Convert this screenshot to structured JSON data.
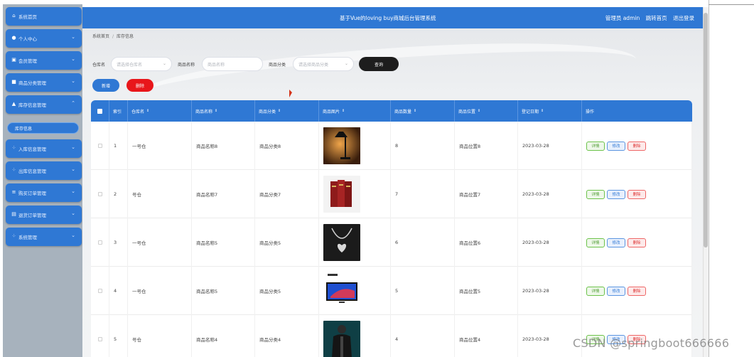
{
  "header": {
    "title": "基于Vue的loving buy商城后台管理系统",
    "user_label": "管理员 admin",
    "home_label": "跳转首页",
    "logout_label": "退出登录"
  },
  "sidebar": {
    "items": [
      {
        "label": "系统首页",
        "icon": "home-icon"
      },
      {
        "label": "个人中心",
        "icon": "user-icon"
      },
      {
        "label": "会员管理",
        "icon": "lock-icon"
      },
      {
        "label": "商品分类管理",
        "icon": "list-icon"
      },
      {
        "label": "库存信息管理",
        "icon": "doc-icon"
      },
      {
        "label": "入库信息管理",
        "icon": "grid-icon"
      },
      {
        "label": "出库信息管理",
        "icon": "grid-icon"
      },
      {
        "label": "购买订单管理",
        "icon": "grid-icon"
      },
      {
        "label": "退货订单管理",
        "icon": "doc-icon"
      },
      {
        "label": "系统管理",
        "icon": "grid-icon"
      }
    ],
    "active_sub": "库存信息"
  },
  "breadcrumb": {
    "home": "系统首页",
    "current": "库存信息"
  },
  "search": {
    "warehouse_label": "仓库名",
    "warehouse_placeholder": "请选择仓库名",
    "product_label": "商品名称",
    "product_placeholder": "商品名称",
    "category_label": "商品分类",
    "category_placeholder": "请选择商品分类",
    "query_button": "查询"
  },
  "actions": {
    "add": "新增",
    "delete": "删除"
  },
  "table": {
    "headers": [
      "索引",
      "仓库名",
      "商品名称",
      "商品分类",
      "商品图片",
      "商品数量",
      "商品位置",
      "登记日期",
      "操作"
    ],
    "ops": {
      "detail": "详情",
      "edit": "修改",
      "remove": "删除"
    },
    "rows": [
      {
        "index": "1",
        "warehouse": "一号仓",
        "name": "商品名称8",
        "category": "商品分类8",
        "qty": "8",
        "location": "商品位置8",
        "date": "2023-03-28",
        "image": "lamp-image"
      },
      {
        "index": "2",
        "warehouse": "号仓",
        "name": "商品名称7",
        "category": "商品分类7",
        "qty": "7",
        "location": "商品位置7",
        "date": "2023-03-28",
        "image": "books-image"
      },
      {
        "index": "3",
        "warehouse": "一号仓",
        "name": "商品名称5",
        "category": "商品分类5",
        "qty": "6",
        "location": "商品位置6",
        "date": "2023-03-28",
        "image": "necklace-image"
      },
      {
        "index": "4",
        "warehouse": "一号仓",
        "name": "商品名称5",
        "category": "商品分类5",
        "qty": "5",
        "location": "商品位置5",
        "date": "2023-03-28",
        "image": "tv-image"
      },
      {
        "index": "5",
        "warehouse": "号仓",
        "name": "商品名称4",
        "category": "商品分类4",
        "qty": "4",
        "location": "商品位置4",
        "date": "2023-03-28",
        "image": "jacket-image"
      }
    ]
  },
  "watermark": "CSDN @springboot666666",
  "colors": {
    "primary": "#2f78d4",
    "danger": "#e8161b",
    "query": "#1d1d1d"
  }
}
